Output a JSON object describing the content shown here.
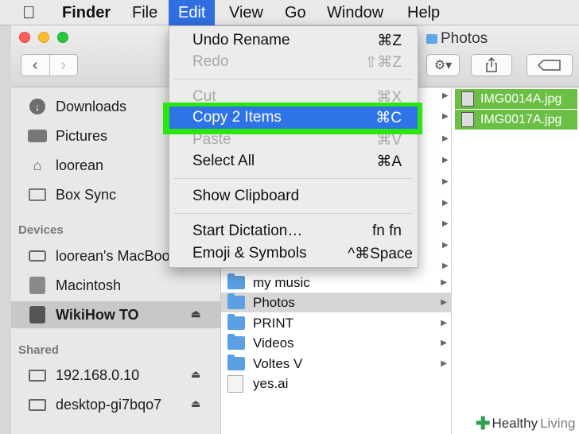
{
  "menubar": {
    "apple": "",
    "items": [
      "Finder",
      "File",
      "Edit",
      "View",
      "Go",
      "Window",
      "Help"
    ]
  },
  "window": {
    "title": "Photos"
  },
  "sidebar": {
    "items": [
      {
        "label": "Downloads",
        "icon": "download-icon"
      },
      {
        "label": "Pictures",
        "icon": "camera-icon"
      },
      {
        "label": "loorean",
        "icon": "home-icon"
      },
      {
        "label": "Box Sync",
        "icon": "folder-icon"
      }
    ],
    "devices_header": "Devices",
    "devices": [
      {
        "label": "loorean's MacBook Pro",
        "icon": "laptop-icon"
      },
      {
        "label": "Macintosh",
        "icon": "hard-drive-icon"
      },
      {
        "label": "WikiHow TO",
        "icon": "external-drive-icon",
        "selected": true
      }
    ],
    "shared_header": "Shared",
    "shared": [
      {
        "label": "192.168.0.10",
        "icon": "monitor-icon"
      },
      {
        "label": "desktop-gi7bqo7",
        "icon": "monitor-icon"
      }
    ],
    "eject": "⏏"
  },
  "columns": {
    "col1": [
      {
        "label": "my music",
        "type": "folder"
      },
      {
        "label": "Photos",
        "type": "folder",
        "selected": true
      },
      {
        "label": "PRINT",
        "type": "folder"
      },
      {
        "label": "Videos",
        "type": "folder"
      },
      {
        "label": "Voltes V",
        "type": "folder"
      },
      {
        "label": "yes.ai",
        "type": "file"
      }
    ],
    "col2": [
      "IMG0014A.jpg",
      "IMG0017A.jpg"
    ]
  },
  "edit_menu": {
    "undo": {
      "label": "Undo Rename",
      "shortcut": "⌘Z"
    },
    "redo": {
      "label": "Redo",
      "shortcut": "⇧⌘Z"
    },
    "cut": {
      "label": "Cut",
      "shortcut": "⌘X"
    },
    "copy": {
      "label": "Copy 2 Items",
      "shortcut": "⌘C"
    },
    "paste": {
      "label": "Paste",
      "shortcut": "⌘V"
    },
    "select_all": {
      "label": "Select All",
      "shortcut": "⌘A"
    },
    "show_clipboard": {
      "label": "Show Clipboard"
    },
    "dictation": {
      "label": "Start Dictation…",
      "shortcut": "fn fn"
    },
    "emoji": {
      "label": "Emoji & Symbols",
      "shortcut": "^⌘Space"
    }
  },
  "watermark": {
    "healthy": "Healthy",
    "living": "Living"
  },
  "colors": {
    "highlight": "#29e60f",
    "selection_blue": "#2f74e6",
    "folder": "#5ba0e2",
    "selected_file": "#6bbf44"
  }
}
